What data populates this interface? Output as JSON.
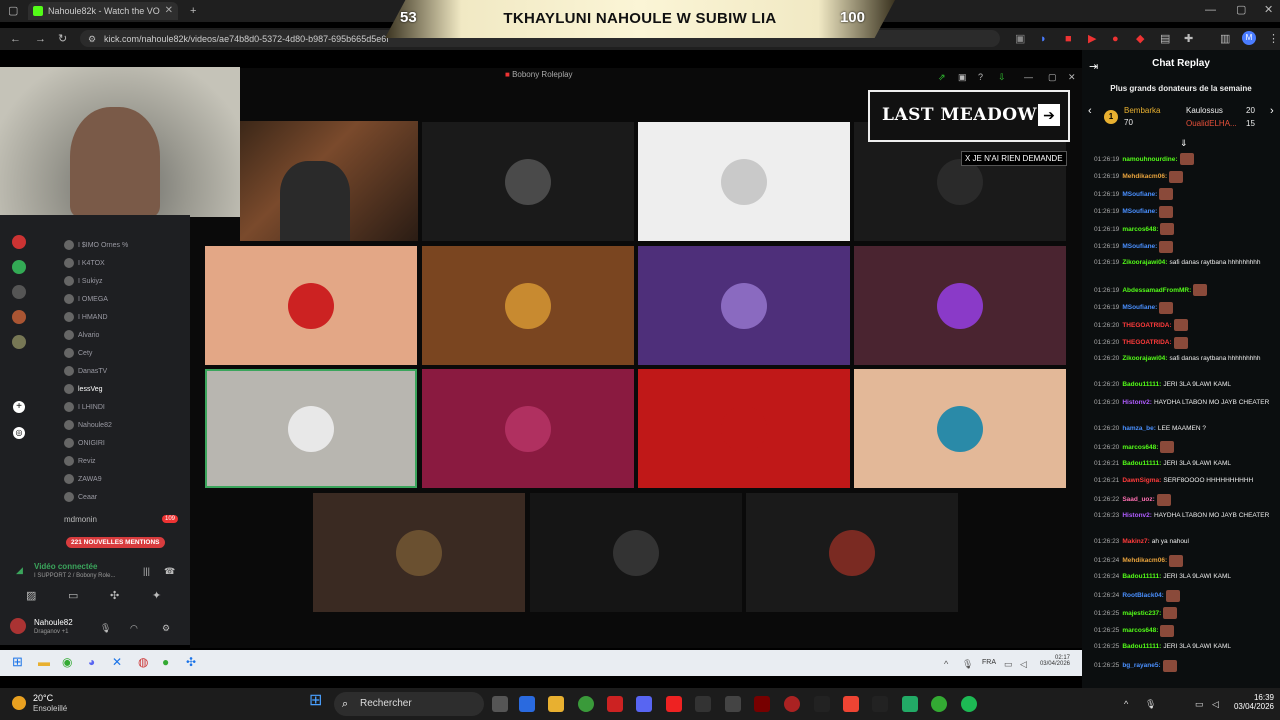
{
  "browser": {
    "tabs": [
      {
        "label": "Nahoule82k - Watch the VO",
        "active": true
      }
    ],
    "url": "kick.com/nahoule82k/videos/ae74b8d0-5372-4d80-b987-695b665d5e6f"
  },
  "overlay": {
    "left_score": "53",
    "title": "TKHAYLUNI NAHOULE W SUBIW LIA",
    "right_score": "100"
  },
  "app_window": {
    "title": "Bobony Roleplay"
  },
  "banner": {
    "text": "LAST MEADOW",
    "note": "X JE N'AI RIEN DEMANDE"
  },
  "discord": {
    "members": [
      "I $IMO Ornes %",
      "I K4TOX",
      "I Sukiyz",
      "I OMEGA",
      "I HMAND",
      "Alvario",
      "Cety",
      "DanasTV",
      "lessVeg",
      "I LHINDI",
      "Nahoule82",
      "ONIGIRI",
      "Reviz",
      "ZAWA9",
      "Ceaar"
    ],
    "server_label": "mdmonin",
    "server_count": "109",
    "mentions": "221 NOUVELLES MENTIONS",
    "voice_status": "Vidéo connectée",
    "voice_channel": "I SUPPORT 2 / Bobony Role...",
    "user_name": "Nahoule82",
    "user_sub": "Draganov +1"
  },
  "chat": {
    "title": "Chat Replay",
    "donors_title": "Plus grands donateurs de la semaine",
    "donors": [
      {
        "name": "Bembarka",
        "amount": "70"
      },
      {
        "name": "Kaulossus",
        "amount": "20"
      },
      {
        "name": "OualidELHA...",
        "amount": "15"
      }
    ],
    "messages": [
      {
        "time": "01:26:19",
        "user": "namouhnourdine:",
        "color": "#53fc18",
        "text": ""
      },
      {
        "time": "01:26:19",
        "user": "Mehdikacm06:",
        "color": "#e8a33d",
        "text": ""
      },
      {
        "time": "01:26:19",
        "user": "MSoufiane:",
        "color": "#4a90ff",
        "text": ""
      },
      {
        "time": "01:26:19",
        "user": "MSoufiane:",
        "color": "#4a90ff",
        "text": ""
      },
      {
        "time": "01:26:19",
        "user": "marcos648:",
        "color": "#53fc18",
        "text": ""
      },
      {
        "time": "01:26:19",
        "user": "MSoufiane:",
        "color": "#4a90ff",
        "text": ""
      },
      {
        "time": "01:26:19",
        "user": "Zikoorajawi04:",
        "color": "#53fc18",
        "text": "safi danas raytbana hhhhhhhhh"
      },
      {
        "time": "01:26:19",
        "user": "AbdessamadFromMR:",
        "color": "#53fc18",
        "text": ""
      },
      {
        "time": "01:26:19",
        "user": "MSoufiane:",
        "color": "#4a90ff",
        "text": ""
      },
      {
        "time": "01:26:20",
        "user": "THEGOATRIDA:",
        "color": "#ff3b3b",
        "text": ""
      },
      {
        "time": "01:26:20",
        "user": "THEGOATRIDA:",
        "color": "#ff3b3b",
        "text": ""
      },
      {
        "time": "01:26:20",
        "user": "Zikoorajawi04:",
        "color": "#53fc18",
        "text": "safi danas raytbana hhhhhhhhh"
      },
      {
        "time": "01:26:20",
        "user": "Badou11111:",
        "color": "#53fc18",
        "text": "JERI 3LA 9LAWI KAML"
      },
      {
        "time": "01:26:20",
        "user": "Histonv2:",
        "color": "#b05cff",
        "text": "HAYDHA LTABON MO JAYB CHEATER"
      },
      {
        "time": "01:26:20",
        "user": "hamza_be:",
        "color": "#4a90ff",
        "text": "LEE MAAMEN ?"
      },
      {
        "time": "01:26:20",
        "user": "marcos648:",
        "color": "#53fc18",
        "text": ""
      },
      {
        "time": "01:26:21",
        "user": "Badou11111:",
        "color": "#53fc18",
        "text": "JERI 3LA 9LAWI KAML"
      },
      {
        "time": "01:26:21",
        "user": "DawnSigma:",
        "color": "#ff3b3b",
        "text": "SERF8OOOO HHHHHHHHHH"
      },
      {
        "time": "01:26:22",
        "user": "Saad_uoz:",
        "color": "#ff6fb1",
        "text": ""
      },
      {
        "time": "01:26:23",
        "user": "Histonv2:",
        "color": "#b05cff",
        "text": "HAYDHA LTABON MO JAYB CHEATER"
      },
      {
        "time": "01:26:23",
        "user": "Makinz7:",
        "color": "#ff3b3b",
        "text": "ah ya nahoul"
      },
      {
        "time": "01:26:24",
        "user": "Mehdikacm06:",
        "color": "#e8a33d",
        "text": ""
      },
      {
        "time": "01:26:24",
        "user": "Badou11111:",
        "color": "#53fc18",
        "text": "JERI 3LA 9LAWI KAML"
      },
      {
        "time": "01:26:24",
        "user": "RootBlack04:",
        "color": "#4a90ff",
        "text": ""
      },
      {
        "time": "01:26:25",
        "user": "majestic237:",
        "color": "#53fc18",
        "text": ""
      },
      {
        "time": "01:26:25",
        "user": "marcos648:",
        "color": "#53fc18",
        "text": ""
      },
      {
        "time": "01:26:25",
        "user": "Badou11111:",
        "color": "#53fc18",
        "text": "JERI 3LA 9LAWI KAML"
      },
      {
        "time": "01:26:25",
        "user": "bg_rayane5:",
        "color": "#4a90ff",
        "text": ""
      }
    ]
  },
  "inner_taskbar": {
    "lang": "FRA",
    "time": "02:17",
    "date": "03/04/2026"
  },
  "taskbar": {
    "weather_temp": "20°C",
    "weather_desc": "Ensoleillé",
    "search_placeholder": "Rechercher",
    "time": "16:39",
    "date": "03/04/2026"
  }
}
